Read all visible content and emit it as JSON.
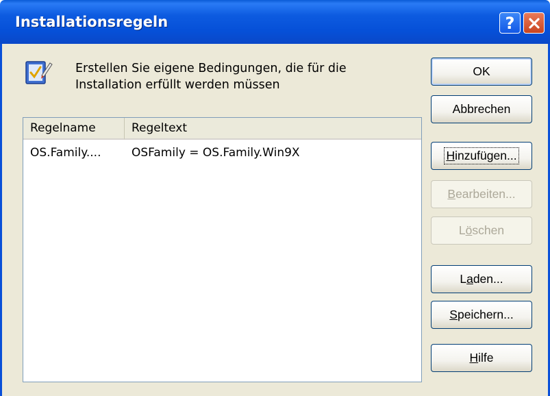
{
  "window": {
    "title": "Installationsregeln"
  },
  "header": {
    "description_line1": "Erstellen Sie eigene Bedingungen, die für die",
    "description_line2": "Installation erfüllt werden müssen"
  },
  "list": {
    "columns": [
      "Regelname",
      "Regeltext"
    ],
    "rows": [
      {
        "name": "OS.Family....",
        "text": "OSFamily = OS.Family.Win9X"
      }
    ]
  },
  "buttons": {
    "ok": "OK",
    "cancel": "Abbrechen",
    "add": {
      "accel": "H",
      "rest": "inzufügen..."
    },
    "edit": {
      "accel": "B",
      "rest": "earbeiten..."
    },
    "delete": {
      "pre": "L",
      "accel": "ö",
      "rest": "schen"
    },
    "load": {
      "pre": "L",
      "accel": "a",
      "rest": "den..."
    },
    "save": {
      "accel": "S",
      "rest": "peichern..."
    },
    "help": {
      "accel": "H",
      "rest": "ilfe"
    }
  },
  "colors": {
    "titlebar": "#0a5bd6",
    "face": "#ece9d8",
    "close": "#c9441f"
  }
}
